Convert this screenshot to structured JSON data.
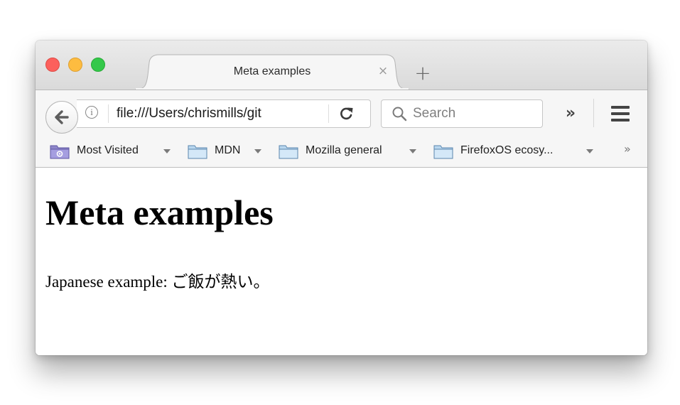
{
  "window": {
    "controls": [
      "close",
      "minimize",
      "maximize"
    ]
  },
  "tab": {
    "title": "Meta examples",
    "close_glyph": "×",
    "new_tab_glyph": "+"
  },
  "toolbar": {
    "url": "file:///Users/chrismills/git",
    "info_glyph": "i",
    "search_placeholder": "Search",
    "overflow_glyph": "»"
  },
  "bookmarks": {
    "items": [
      {
        "label": "Most Visited",
        "icon": "most-visited-folder-icon"
      },
      {
        "label": "MDN",
        "icon": "folder-icon"
      },
      {
        "label": "Mozilla general",
        "icon": "folder-icon"
      },
      {
        "label": "FirefoxOS ecosy...",
        "icon": "folder-icon"
      }
    ],
    "overflow_glyph": "»"
  },
  "page": {
    "heading": "Meta examples",
    "paragraph": "Japanese example: ご飯が熱い。"
  },
  "colors": {
    "close": "#fc605c",
    "minimize": "#fdbc40",
    "maximize": "#34c84a",
    "chrome": "#f6f6f6",
    "tabstrip": "#dadada"
  }
}
